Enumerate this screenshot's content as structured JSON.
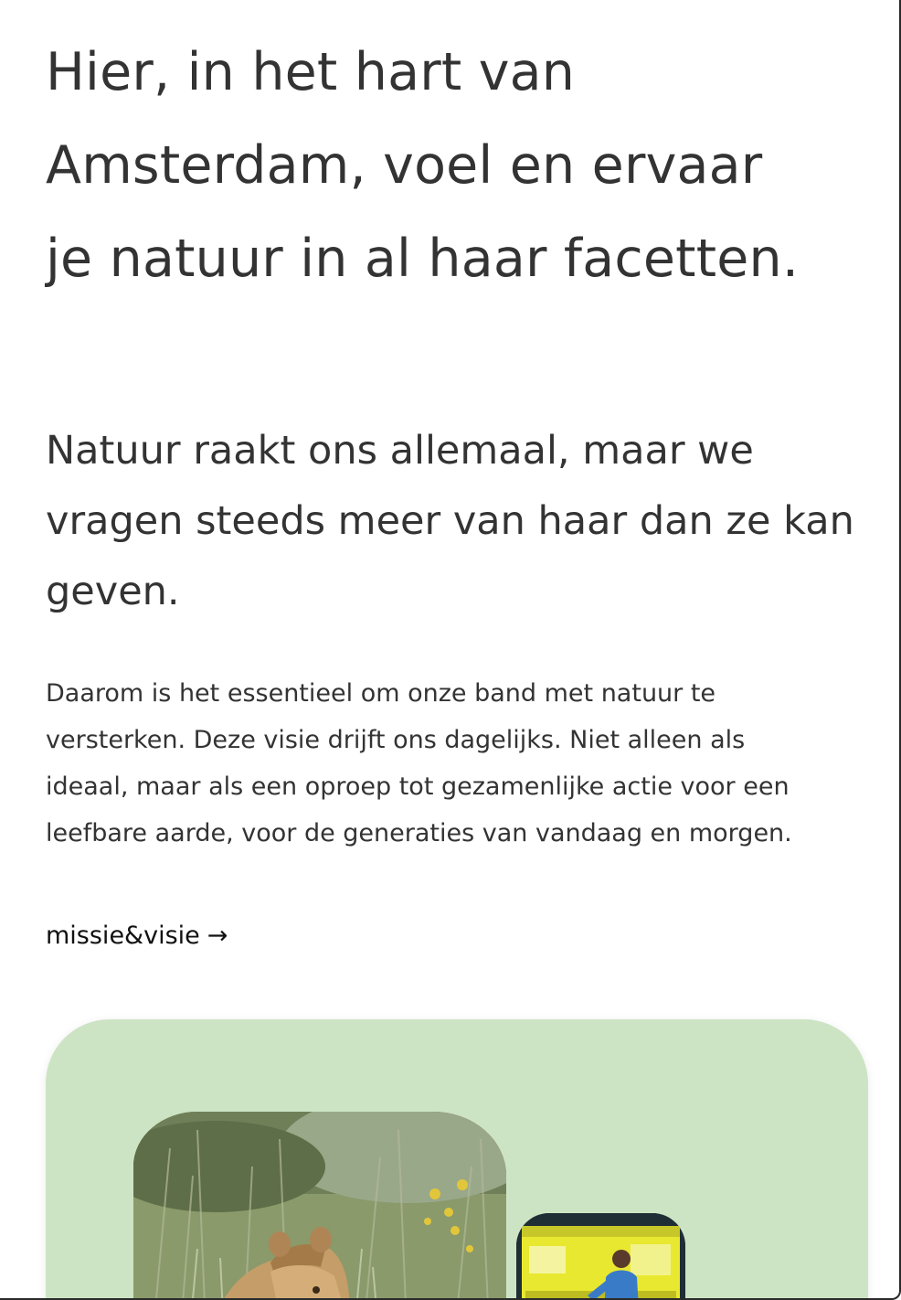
{
  "hero": {
    "title_lines": [
      "Hier, in het hart van",
      "Amsterdam, voel en ervaar",
      "je natuur in al haar facetten."
    ]
  },
  "intro": {
    "subtitle_lines": [
      "Natuur raakt ons allemaal, maar we",
      "vragen steeds meer van haar dan ze kan",
      "geven."
    ],
    "body_lines": [
      "Daarom is het essentieel om onze band met natuur te",
      "versterken. Deze visie drijft ons dagelijks. Niet alleen als",
      "ideaal, maar als een oproep tot gezamenlijke actie voor een",
      "leefbare aarde, voor de generaties van vandaag en morgen."
    ]
  },
  "link": {
    "label": "missie&visie",
    "arrow": "→"
  },
  "colors": {
    "text": "#333333",
    "card_background": "#cde4c4",
    "lab_yellow": "#e8e830"
  },
  "images": {
    "lion_photo": "lioness-in-grass-photo",
    "lab_photo": "person-in-yellow-lab-photo"
  }
}
